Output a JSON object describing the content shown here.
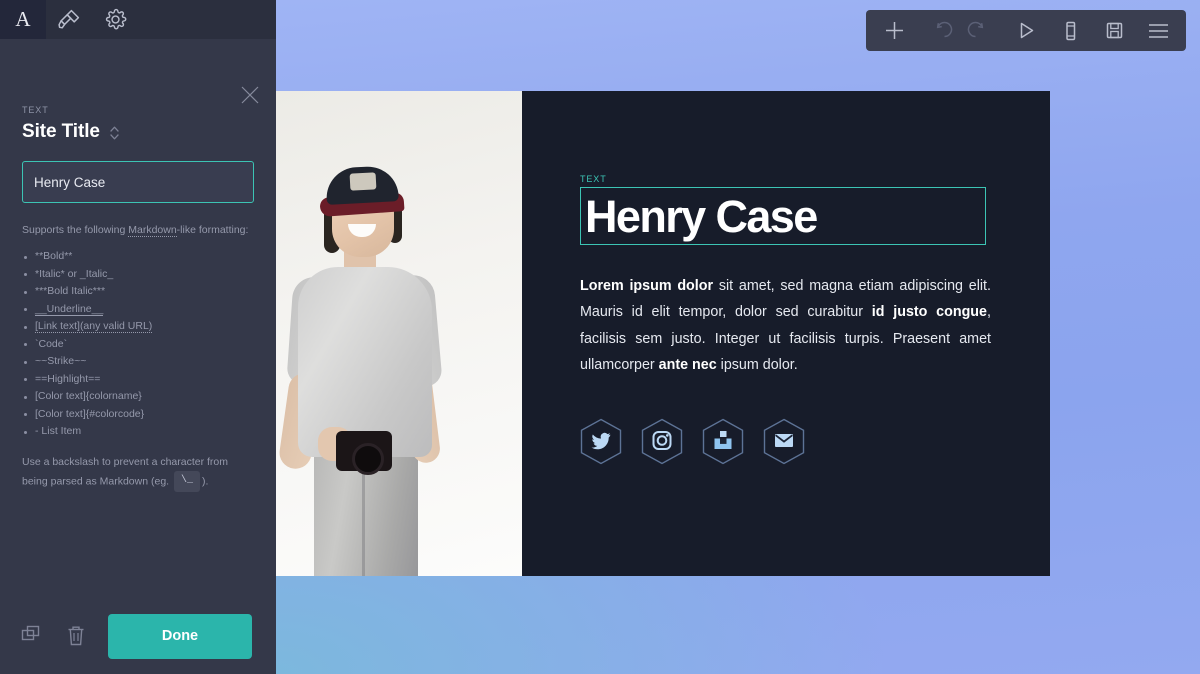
{
  "editor": {
    "tabs": [
      {
        "name": "text-tab",
        "icon": "letter-a-icon",
        "label": "A",
        "active": true
      },
      {
        "name": "style-tab",
        "icon": "paint-brush-icon",
        "label": "",
        "active": false
      },
      {
        "name": "settings-tab",
        "icon": "gear-icon",
        "label": "",
        "active": false
      }
    ],
    "close_icon": "close-icon",
    "field": {
      "kicker": "TEXT",
      "title": "Site Title",
      "stepper_icon": "chevron-up-down-icon",
      "input_value": "Henry Case",
      "input_placeholder": "Site Title"
    },
    "help": {
      "intro_pre": "Supports the following ",
      "intro_link": "Markdown",
      "intro_post": "-like formatting:",
      "items": [
        "**Bold**",
        "*Italic* or _Italic_",
        "***Bold Italic***",
        "__Underline__",
        "[Link text](any valid URL)",
        "`Code`",
        "~~Strike~~",
        "==Highlight==",
        "[Color text]{colorname}",
        "[Color text]{#colorcode}",
        "- List Item"
      ],
      "note_pre": "Use a backslash to prevent a character from being parsed as Markdown (eg. ",
      "note_code": "\\_",
      "note_post": ")."
    },
    "footer": {
      "duplicate_icon": "duplicate-icon",
      "delete_icon": "trash-icon",
      "done_label": "Done"
    }
  },
  "toolbar": {
    "buttons": [
      {
        "name": "add-button",
        "icon": "plus-icon",
        "disabled": false
      },
      {
        "name": "undo-button",
        "icon": "undo-icon",
        "disabled": true
      },
      {
        "name": "redo-button",
        "icon": "redo-icon",
        "disabled": true
      },
      {
        "name": "preview-button",
        "icon": "play-icon",
        "disabled": false
      },
      {
        "name": "mobile-preview-button",
        "icon": "mobile-icon",
        "disabled": false
      },
      {
        "name": "save-button",
        "icon": "save-disk-icon",
        "disabled": false
      },
      {
        "name": "menu-button",
        "icon": "hamburger-menu-icon",
        "disabled": false
      }
    ]
  },
  "site": {
    "photo_alt": "Smiling man in cap and grey t-shirt holding a camera",
    "kicker": "TEXT",
    "headline": "Henry Case",
    "body": {
      "segments": [
        {
          "text": "Lorem ipsum dolor",
          "bold": true
        },
        {
          "text": " sit amet, sed magna etiam adipiscing elit. Mauris id elit tempor, dolor sed curabitur ",
          "bold": false
        },
        {
          "text": "id justo congue",
          "bold": true
        },
        {
          "text": ", facilisis sem justo. Integer ut facilisis turpis. Praesent amet ullamcorper ",
          "bold": false
        },
        {
          "text": "ante nec",
          "bold": true
        },
        {
          "text": " ipsum dolor.",
          "bold": false
        }
      ]
    },
    "socials": [
      {
        "name": "social-twitter",
        "icon": "twitter-icon"
      },
      {
        "name": "social-instagram",
        "icon": "instagram-icon"
      },
      {
        "name": "social-dropbox",
        "icon": "inbox-tray-icon"
      },
      {
        "name": "social-email",
        "icon": "envelope-icon"
      }
    ]
  },
  "colors": {
    "accent_teal": "#3cc4b4",
    "done_button": "#2bb5ab",
    "sidebar_bg": "#343849",
    "tabbar_bg": "#2b2f3e",
    "panel_dark": "#171c2a",
    "canvas_blue": "#8fa6ef",
    "canvas_sky": "#7cb8dd",
    "social_icon": "#bcd9f5"
  }
}
